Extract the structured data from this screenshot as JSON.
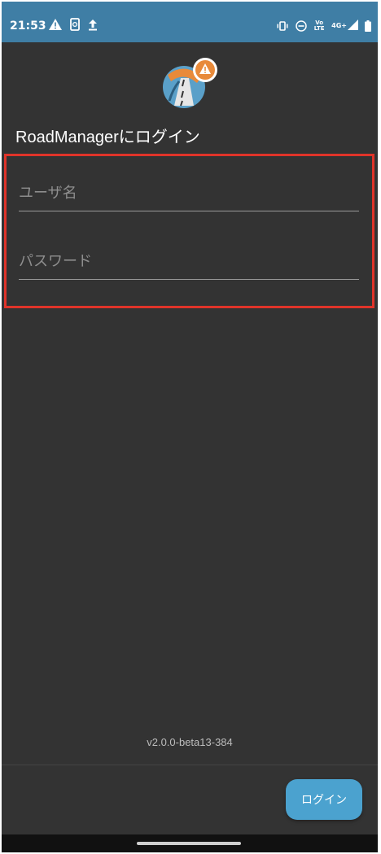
{
  "status_bar": {
    "time": "21:53",
    "left_icons": [
      "warning-icon",
      "phone-refresh-icon",
      "upload-icon"
    ],
    "right_icons": [
      "vibrate-icon",
      "dnd-icon",
      "volte-icon",
      "4g-signal-icon",
      "battery-icon"
    ],
    "volte_text": "Vo LTE",
    "network_text": "4G+"
  },
  "app": {
    "title": "RoadManagerにログイン",
    "logo": "roadmanager-logo"
  },
  "form": {
    "username_placeholder": "ユーザ名",
    "username_value": "",
    "password_placeholder": "パスワード",
    "password_value": ""
  },
  "footer": {
    "version": "v2.0.0-beta13-384",
    "login_label": "ログイン"
  },
  "colors": {
    "status_bar": "#3f7ea5",
    "background": "#333333",
    "highlight_border": "#e0342a",
    "login_button": "#4ba2cf"
  }
}
